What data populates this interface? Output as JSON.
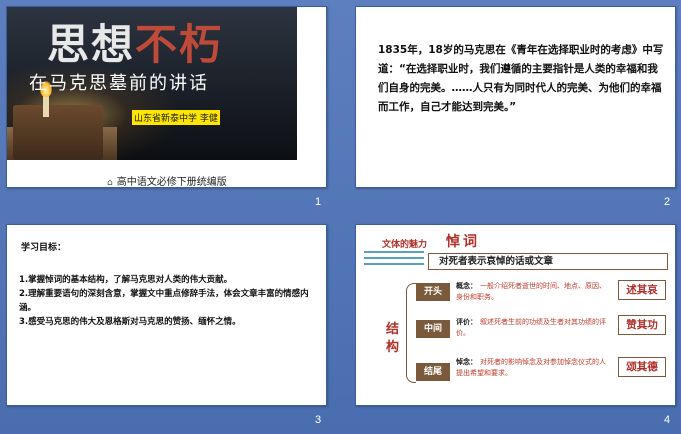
{
  "slides": [
    {
      "number": "1",
      "title_part1": "思想",
      "title_part2": "不朽",
      "subtitle": "在马克思墓前的讲话",
      "author": "山东省新泰中学 李健",
      "caption_icon": "bookmark-icon",
      "caption": "高中语文必修下册统编版"
    },
    {
      "number": "2",
      "text": "1835年，18岁的马克思在《青年在选择职业时的考虑》中写道：“在选择职业时，我们遵循的主要指针是人类的幸福和我们自身的完美。……人只有为同时代人的完美、为他们的幸福而工作，自己才能达到完美。”"
    },
    {
      "number": "3",
      "heading": "学习目标：",
      "items": [
        "1.掌握悼词的基本结构，了解马克思对人类的伟大贡献。",
        "2.理解重要语句的深刻含意，掌握文中重点修辞手法，体会文章丰富的情感内涵。",
        "3.感受马克思的伟大及恩格斯对马克思的赞扬、缅怀之情。"
      ]
    },
    {
      "number": "4",
      "section_label": "文体的魅力",
      "title": "悼词",
      "definition": "对死者表示哀悼的话或文章",
      "structure_label": "结构",
      "parts": [
        {
          "tag": "开头",
          "key": "概念：",
          "desc": "一般介绍死者逝世的时间、地点、原因、身份和职务。",
          "result": "述其哀"
        },
        {
          "tag": "中间",
          "key": "评价：",
          "desc": "叙述死者生前的功绩及生者对其功绩的评价。",
          "result": "赞其功"
        },
        {
          "tag": "结尾",
          "key": "悼念：",
          "desc": "对死者的影响悼念及对参加悼念仪式的人提出希望和要求。",
          "result": "颂其德"
        }
      ]
    }
  ],
  "colors": {
    "background": "#4a6db0",
    "accent_red": "#b0302a",
    "tag_brown": "#7a5a3a",
    "highlight_yellow": "#ffe600"
  }
}
